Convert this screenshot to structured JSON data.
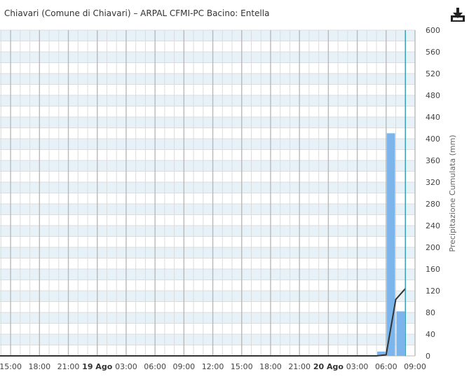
{
  "header": {
    "title": "Chiavari (Comune di Chiavari) – ARPAL CFMI-PC Bacino: Entella"
  },
  "icons": {
    "download": "download-icon"
  },
  "colors": {
    "bar": "#7cb5ec",
    "line": "#333333",
    "band": "#e6f2f8",
    "grid_major": "#b9b9b9",
    "grid_minor": "#dcdcdc",
    "cursor": "#3aa0b8"
  },
  "chart_data": {
    "type": "bar",
    "ylabel": "Precipitazione Cumulata (mm)",
    "ylim": [
      0,
      600
    ],
    "y_ticks": [
      0,
      40,
      80,
      120,
      160,
      200,
      240,
      280,
      320,
      360,
      400,
      440,
      480,
      520,
      560,
      600
    ],
    "x_unit": "hours from 18 Ago 15:00",
    "xlim": [
      -1.1,
      42.0
    ],
    "x_ticks": [
      {
        "t": 0,
        "label": "15:00",
        "bold": false
      },
      {
        "t": 3,
        "label": "18:00",
        "bold": false
      },
      {
        "t": 6,
        "label": "21:00",
        "bold": false
      },
      {
        "t": 9,
        "label": "19 Ago",
        "bold": true
      },
      {
        "t": 12,
        "label": "03:00",
        "bold": false
      },
      {
        "t": 15,
        "label": "06:00",
        "bold": false
      },
      {
        "t": 18,
        "label": "09:00",
        "bold": false
      },
      {
        "t": 21,
        "label": "12:00",
        "bold": false
      },
      {
        "t": 24,
        "label": "15:00",
        "bold": false
      },
      {
        "t": 27,
        "label": "18:00",
        "bold": false
      },
      {
        "t": 30,
        "label": "21:00",
        "bold": false
      },
      {
        "t": 33,
        "label": "20 Ago",
        "bold": true
      },
      {
        "t": 36,
        "label": "03:00",
        "bold": false
      },
      {
        "t": 39,
        "label": "06:00",
        "bold": false
      },
      {
        "t": 42,
        "label": "09:00",
        "bold": false
      }
    ],
    "bars": [
      {
        "t_start": 38.0,
        "t_end": 39.0,
        "value": 8
      },
      {
        "t_start": 39.0,
        "t_end": 40.0,
        "value": 410
      },
      {
        "t_start": 40.0,
        "t_end": 41.0,
        "value": 82
      }
    ],
    "series": [
      {
        "type": "line",
        "x": [
          -1.1,
          38.0,
          39.0,
          40.0,
          41.0
        ],
        "y": [
          0,
          0,
          2,
          104,
          124
        ]
      }
    ],
    "cursor_t": 41.0
  }
}
